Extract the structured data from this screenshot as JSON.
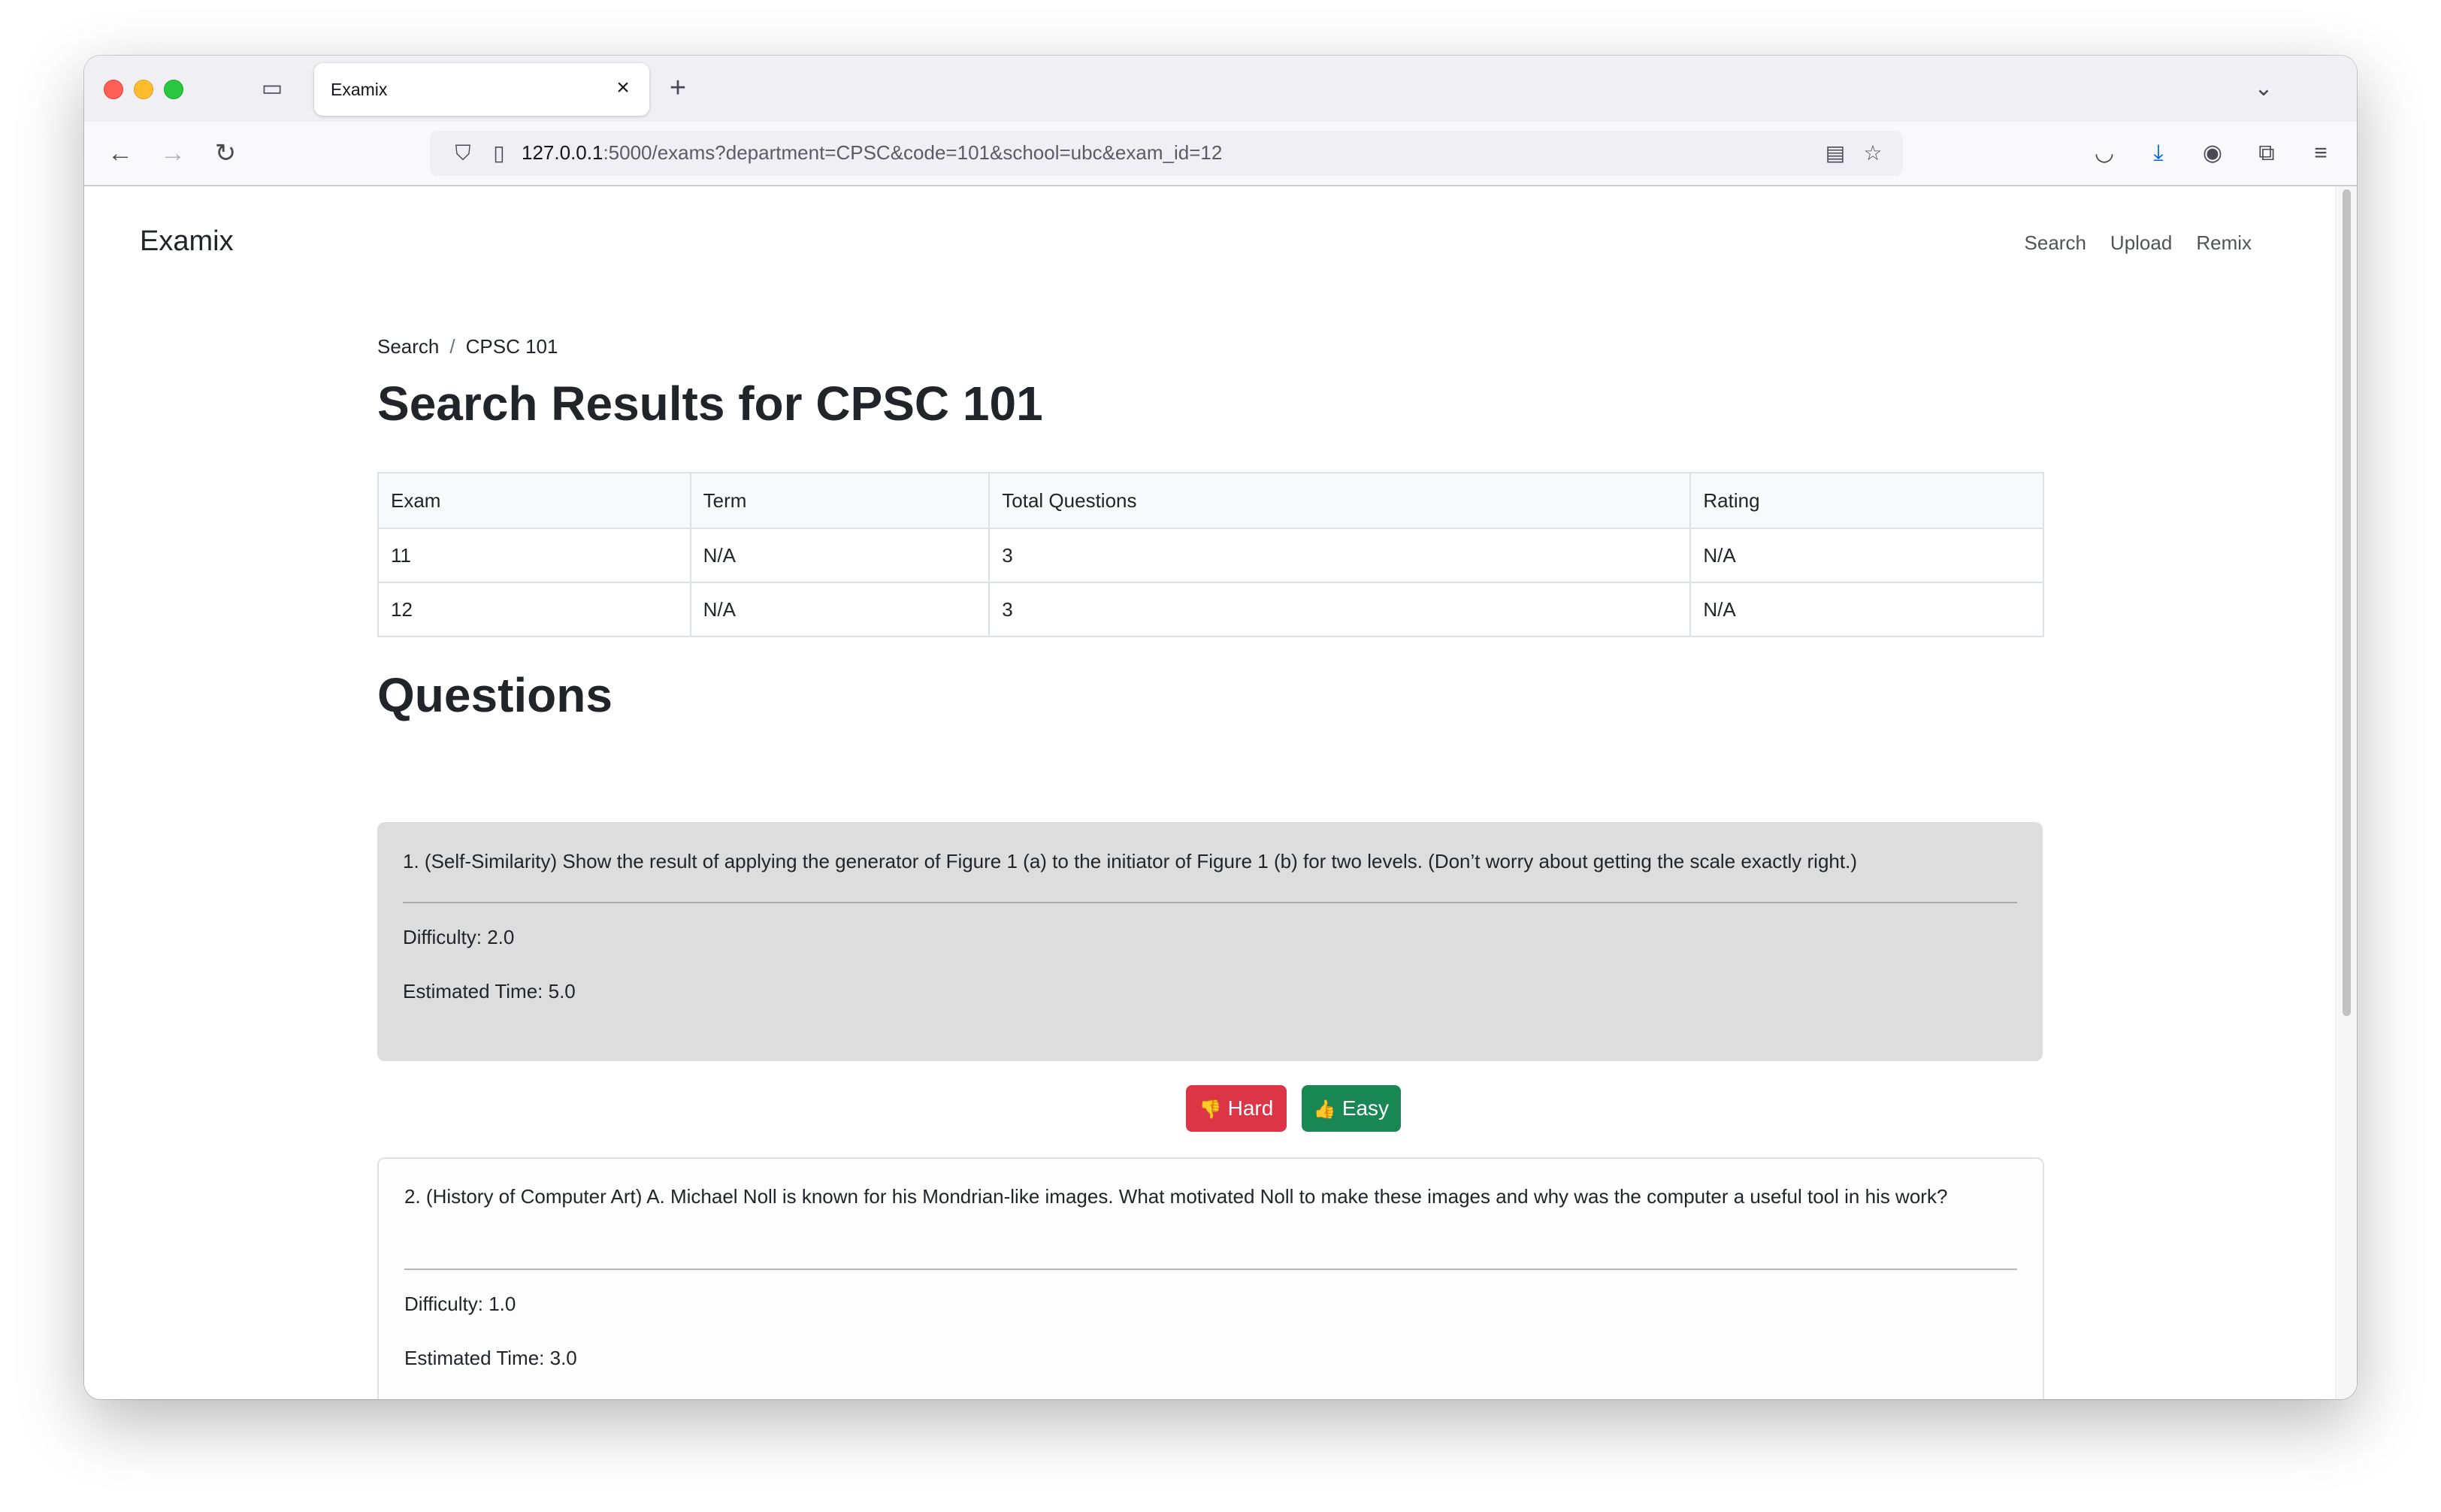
{
  "browser": {
    "tab_title": "Examix",
    "url_host": "127.0.0.1",
    "url_rest": ":5000/exams?department=CPSC&code=101&school=ubc&exam_id=12"
  },
  "nav": {
    "brand": "Examix",
    "links": [
      "Search",
      "Upload",
      "Remix"
    ]
  },
  "breadcrumb": {
    "items": [
      "Search",
      "CPSC 101"
    ],
    "separator": "/"
  },
  "page_title": "Search Results for CPSC 101",
  "exams_table": {
    "headers": [
      "Exam",
      "Term",
      "Total Questions",
      "Rating"
    ],
    "rows": [
      [
        "11",
        "N/A",
        "3",
        "N/A"
      ],
      [
        "12",
        "N/A",
        "3",
        "N/A"
      ]
    ]
  },
  "questions_heading": "Questions",
  "questions": [
    {
      "text": "1. (Self-Similarity) Show the result of applying the generator of Figure 1 (a) to the initiator of Figure 1 (b) for two levels. (Don’t worry about getting the scale exactly right.)",
      "difficulty": "Difficulty: 2.0",
      "time": "Estimated Time: 5.0"
    },
    {
      "text": "2. (History of Computer Art) A. Michael Noll is known for his Mondrian-like images. What motivated Noll to make these images and why was the computer a useful tool in his work?",
      "difficulty": "Difficulty: 1.0",
      "time": "Estimated Time: 3.0"
    }
  ],
  "vote_buttons": {
    "hard": "Hard",
    "easy": "Easy"
  },
  "colors": {
    "hard": "#dc3545",
    "easy": "#198754",
    "card_active": "#dddddd"
  }
}
